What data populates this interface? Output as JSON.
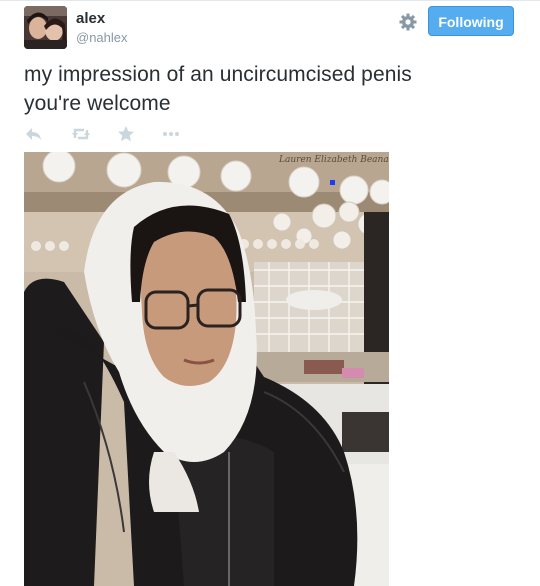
{
  "user": {
    "name": "alex",
    "handle": "@nahlex",
    "avatar_icon": "profile-photo"
  },
  "follow_button": {
    "label": "Following"
  },
  "settings_icon": "gear-icon",
  "tweet": {
    "lines": [
      "my impression of an uncircumcised penis",
      "you're welcome"
    ]
  },
  "actions": [
    {
      "name": "reply-icon"
    },
    {
      "name": "retweet-icon"
    },
    {
      "name": "favorite-icon"
    },
    {
      "name": "more-icon"
    }
  ],
  "photo": {
    "sign_text": "Lauren Elizabeth Beana"
  },
  "colors": {
    "accent": "#55acee",
    "text": "#292f33",
    "muted": "#8899a6",
    "icon": "#ccd6dd"
  }
}
